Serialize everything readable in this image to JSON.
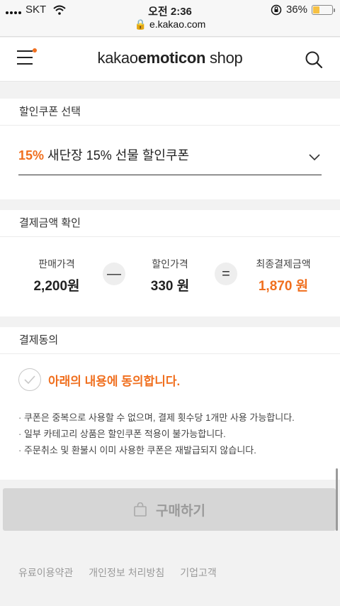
{
  "status_bar": {
    "carrier": "SKT",
    "time": "오전 2:36",
    "url": "e.kakao.com",
    "battery": "36%",
    "battery_level": 0.36
  },
  "header": {
    "logo_regular": "kakao",
    "logo_bold": "emoticon",
    "logo_suffix": " shop"
  },
  "coupon": {
    "section_title": "할인쿠폰 선택",
    "selected_percent": "15%",
    "selected_name": " 새단장 15% 선물 할인쿠폰"
  },
  "payment": {
    "section_title": "결제금액 확인",
    "sale_label": "판매가격",
    "sale_value": "2,200원",
    "minus": "—",
    "discount_label": "할인가격",
    "discount_value": "330 원",
    "equals": "=",
    "final_label": "최종결제금액",
    "final_value": "1,870 원"
  },
  "agreement": {
    "section_title": "결제동의",
    "agree_text": "아래의 내용에 동의합니다.",
    "notices": [
      "쿠폰은 중복으로 사용할 수 없으며, 결제 횟수당 1개만 사용 가능합니다.",
      "일부 카테고리 상품은 할인쿠폰 적용이 불가능합니다.",
      "주문취소 및 환불시 이미 사용한 쿠폰은 재발급되지 않습니다."
    ]
  },
  "buy_button": {
    "label": "구매하기"
  },
  "footer": {
    "links": [
      "유료이용약관",
      "개인정보 처리방침",
      "기업고객"
    ]
  },
  "colors": {
    "accent": "#f06f1e",
    "button_disabled": "#d6d6d6"
  }
}
